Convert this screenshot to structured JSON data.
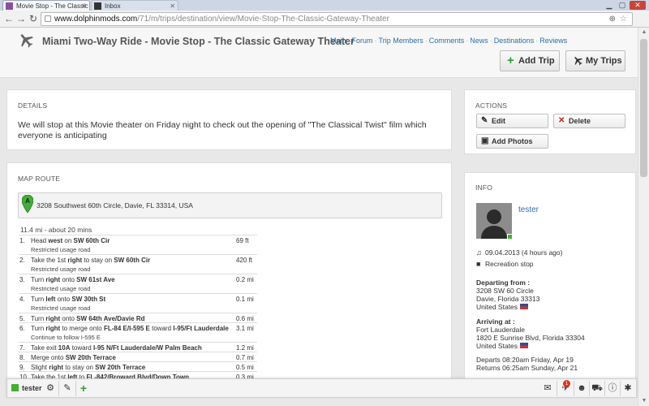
{
  "browser": {
    "tabs": [
      {
        "title": "Movie Stop - The Classic G"
      },
      {
        "title": "Inbox"
      }
    ],
    "url_host": "www.dolphinmods.com",
    "url_path": "/71/m/trips/destination/view/Movie-Stop-The-Classic-Gateway-Theater"
  },
  "header": {
    "title": "Miami Two-Way Ride - Movie Stop - The Classic Gateway Theater",
    "nav": [
      "Main",
      "Forum",
      "Trip Members",
      "Comments",
      "News",
      "Destinations",
      "Reviews"
    ],
    "add_trip_label": "Add Trip",
    "my_trips_label": "My Trips"
  },
  "details": {
    "heading": "DETAILS",
    "text": "We will stop at this Movie theater on Friday night to check out the opening of \"The Classical Twist\" film which everyone is anticipating"
  },
  "actions": {
    "heading": "ACTIONS",
    "edit_label": "Edit",
    "delete_label": "Delete",
    "add_photos_label": "Add Photos"
  },
  "map_route": {
    "heading": "MAP ROUTE",
    "pin_letter": "A",
    "address": "3208 Southwest 60th Circle, Davie, FL 33314, USA",
    "summary": "11.4 mi - about 20 mins",
    "steps": [
      {
        "num": "1.",
        "pre": "Head ",
        "b1": "west",
        "mid": " on ",
        "b2": "SW 60th Cir",
        "post": "",
        "sub": "Restricted usage road",
        "dist": "69 ft"
      },
      {
        "num": "2.",
        "pre": "Take the 1st ",
        "b1": "right",
        "mid": " to stay on ",
        "b2": "SW 60th Cir",
        "post": "",
        "sub": "Restricted usage road",
        "dist": "420 ft"
      },
      {
        "num": "3.",
        "pre": "Turn ",
        "b1": "right",
        "mid": " onto ",
        "b2": "SW 61st Ave",
        "post": "",
        "sub": "Restricted usage road",
        "dist": "0.2 mi"
      },
      {
        "num": "4.",
        "pre": "Turn ",
        "b1": "left",
        "mid": " onto ",
        "b2": "SW 30th St",
        "post": "",
        "sub": "Restricted usage road",
        "dist": "0.1 mi"
      },
      {
        "num": "5.",
        "pre": "Turn ",
        "b1": "right",
        "mid": " onto ",
        "b2": "SW 64th Ave/Davie Rd",
        "post": "",
        "sub": "",
        "dist": "0.6 mi"
      },
      {
        "num": "6.",
        "pre": "Turn ",
        "b1": "right",
        "mid": " to merge onto ",
        "b2": "FL-84 E/I-595 E",
        "post": " toward ",
        "b3": "I-95/Ft Lauderdale",
        "sub": "Continue to follow I-595 E",
        "dist": "3.1 mi"
      },
      {
        "num": "7.",
        "pre": "Take exit ",
        "b1": "10A",
        "mid": " toward ",
        "b2": "I-95 N/Ft Lauderdale/W Palm Beach",
        "post": "",
        "sub": "",
        "dist": "1.2 mi"
      },
      {
        "num": "8.",
        "pre": "Merge onto ",
        "b1": "SW 20th Terrace",
        "mid": "",
        "b2": "",
        "post": "",
        "sub": "",
        "dist": "0.7 mi"
      },
      {
        "num": "9.",
        "pre": "Slight ",
        "b1": "right",
        "mid": " to stay on ",
        "b2": "SW 20th Terrace",
        "post": "",
        "sub": "",
        "dist": "0.5 mi"
      },
      {
        "num": "10.",
        "pre": "Take the 1st ",
        "b1": "left",
        "mid": " to ",
        "b2": "FL-842/Broward Blvd/Down Town",
        "post": "",
        "sub": "",
        "dist": "0.3 mi"
      }
    ]
  },
  "info": {
    "heading": "INFO",
    "username": "tester",
    "date": "09.04.2013 (4 hours ago)",
    "category": "Recreation stop",
    "departing_label": "Departing from :",
    "departing_address": [
      "3208 SW 60 Circle",
      "Davie, Florida 33313",
      "United States"
    ],
    "arriving_label": "Arriving at :",
    "arriving_address": [
      "Fort Lauderdale",
      "1820 E Sunrise Blvd, Florida 33304",
      "United States"
    ],
    "departs": "Departs 08:20am Friday, Apr 19",
    "returns": "Returns 06:25am Sunday, Apr 21"
  },
  "bottombar": {
    "username": "tester",
    "notifications_count": "1"
  },
  "colors": {
    "link": "#2f6ea8",
    "online": "#41b12d",
    "delete": "#cc2222",
    "add": "#2e9d3a"
  }
}
